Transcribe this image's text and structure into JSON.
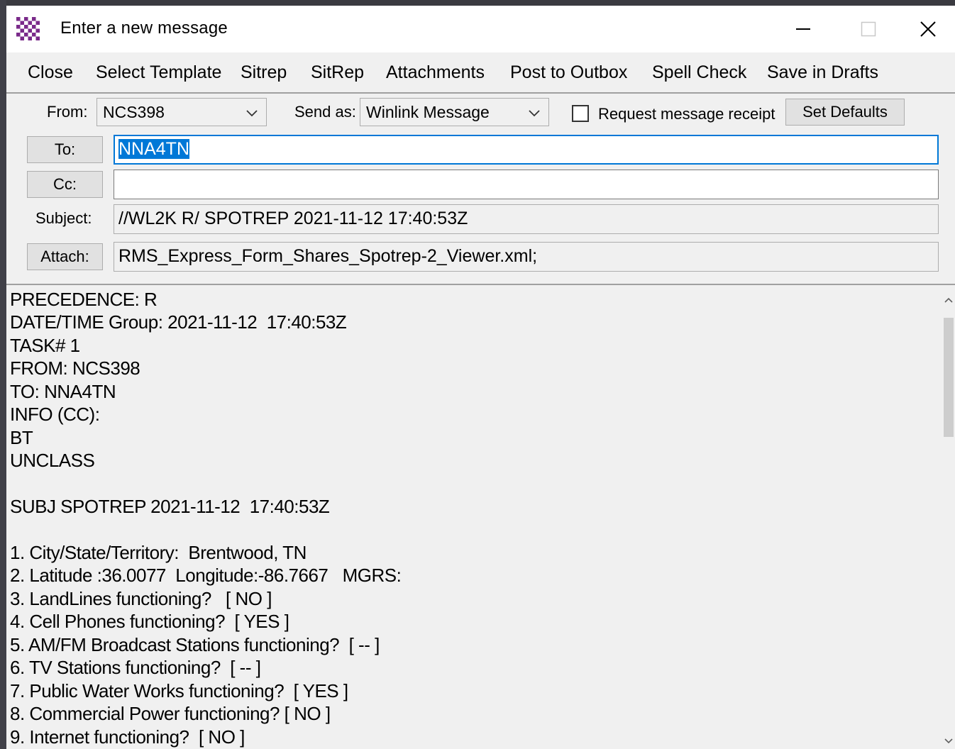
{
  "window": {
    "title": "Enter a new message"
  },
  "menu": [
    "Close",
    "Select Template",
    "Sitrep",
    "SitRep",
    "Attachments",
    "Post to Outbox",
    "Spell Check",
    "Save in Drafts"
  ],
  "form": {
    "from_label": "From:",
    "from_value": "NCS398",
    "send_as_label": "Send as:",
    "send_as_value": "Winlink Message",
    "receipt_label": "Request message receipt",
    "receipt_checked": false,
    "set_defaults_label": "Set Defaults",
    "to_label": "To:",
    "to_value": "NNA4TN",
    "cc_label": "Cc:",
    "cc_value": "",
    "subject_label": "Subject:",
    "subject_value": "//WL2K R/ SPOTREP 2021-11-12  17:40:53Z",
    "attach_label": "Attach:",
    "attach_value": "RMS_Express_Form_Shares_Spotrep-2_Viewer.xml;"
  },
  "body_lines": [
    "PRECEDENCE: R",
    "DATE/TIME Group: 2021-11-12  17:40:53Z",
    "TASK# 1",
    "FROM: NCS398",
    "TO: NNA4TN",
    "INFO (CC):",
    "BT",
    "UNCLASS",
    "",
    "SUBJ SPOTREP 2021-11-12  17:40:53Z",
    "",
    "1. City/State/Territory:  Brentwood, TN",
    "2. Latitude :36.0077  Longitude:-86.7667   MGRS:",
    "3. LandLines functioning?   [ NO ]",
    "4. Cell Phones functioning?  [ YES ]",
    "5. AM/FM Broadcast Stations functioning?  [ -- ]",
    "6. TV Stations functioning?  [ -- ]",
    "7. Public Water Works functioning?  [ YES ]",
    "8. Commercial Power functioning? [ NO ]",
    "9. Internet functioning?  [ NO ]"
  ],
  "icons": {
    "app": "winlink-app-icon",
    "minimize": "minimize-icon",
    "maximize": "maximize-icon",
    "close": "close-icon"
  }
}
